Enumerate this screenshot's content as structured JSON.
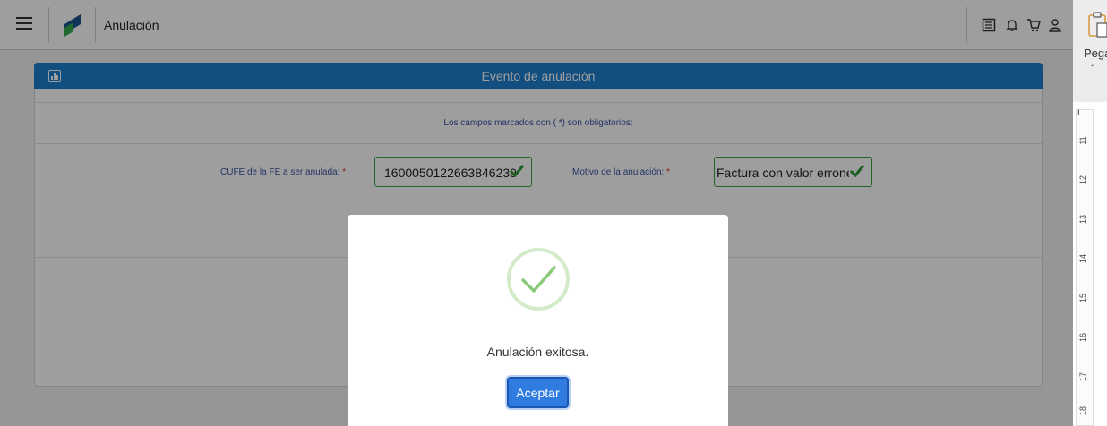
{
  "app": {
    "title": "Anulación",
    "top_icons": [
      "list-icon",
      "bell-icon",
      "cart-icon",
      "user-icon"
    ]
  },
  "panel": {
    "title": "Evento de anulación",
    "header_icon": "chart-icon",
    "note": "Los campos marcados con ( *) son obligatorios:",
    "cufe": {
      "label": "CUFE de la FE a ser anulada:",
      "required_mark": "*",
      "value": "1600050122663846239"
    },
    "motivo": {
      "label": "Motivo de la anulación:",
      "required_mark": "*",
      "value": "Factura con valor erroneo"
    }
  },
  "side": {
    "paste_label": "Pega",
    "paste_chevron": "ˇ",
    "ruler_corner": "L",
    "ruler_numbers": [
      "11",
      "12",
      "13",
      "14",
      "15",
      "16",
      "17",
      "18"
    ]
  },
  "modal": {
    "icon": "success-check-icon",
    "message": "Anulación exitosa.",
    "accept_label": "Aceptar"
  },
  "colors": {
    "accent": "#1d7fcf",
    "success": "#3da13d",
    "label_blue": "#3a53a4",
    "required_red": "#e03030"
  }
}
